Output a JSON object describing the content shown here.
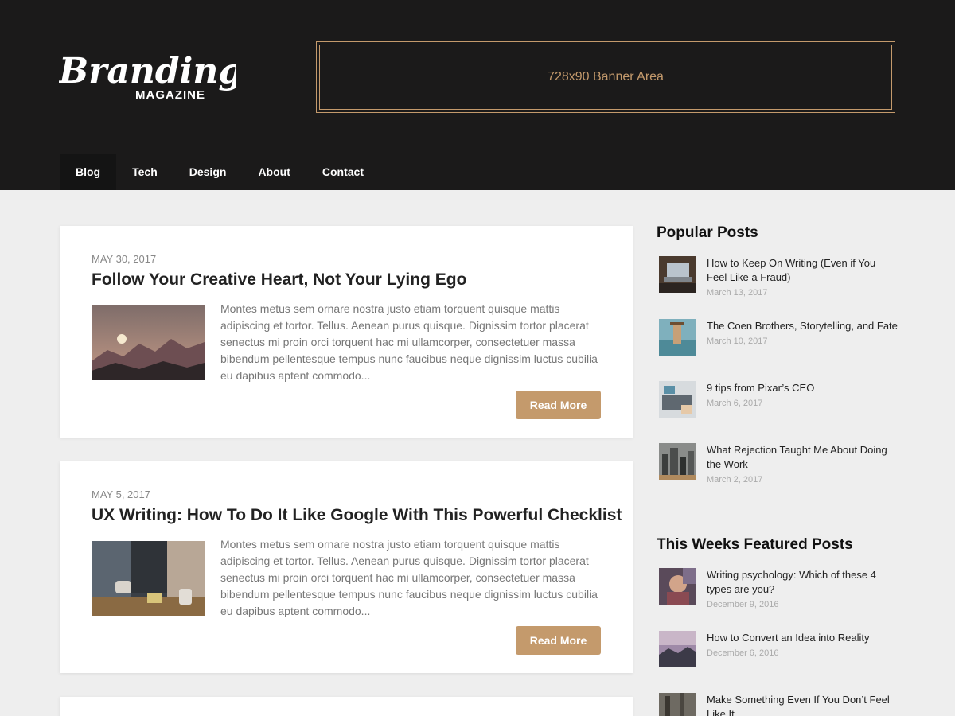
{
  "header": {
    "logo_text": "Branding",
    "logo_sub": "MAGAZINE",
    "banner_text": "728x90 Banner Area"
  },
  "nav": {
    "items": [
      {
        "label": "Blog"
      },
      {
        "label": "Tech"
      },
      {
        "label": "Design"
      },
      {
        "label": "About"
      },
      {
        "label": "Contact"
      }
    ]
  },
  "posts": [
    {
      "date": "MAY 30, 2017",
      "title": "Follow Your Creative Heart, Not Your Lying Ego",
      "excerpt": "Montes metus sem ornare nostra justo etiam torquent quisque mattis adipiscing et tortor. Tellus. Aenean purus quisque. Dignissim tortor placerat senectus mi proin orci torquent hac mi ullamcorper, consectetuer massa bibendum pellentesque tempus nunc faucibus neque dignissim luctus cubilia eu dapibus aptent commodo...",
      "read_more": "Read More"
    },
    {
      "date": "MAY 5, 2017",
      "title": "UX Writing: How To Do It Like Google With This Powerful Checklist",
      "excerpt": "Montes metus sem ornare nostra justo etiam torquent quisque mattis adipiscing et tortor. Tellus. Aenean purus quisque. Dignissim tortor placerat senectus mi proin orci torquent hac mi ullamcorper, consectetuer massa bibendum pellentesque tempus nunc faucibus neque dignissim luctus cubilia eu dapibus aptent commodo...",
      "read_more": "Read More"
    }
  ],
  "sidebar": {
    "popular_title": "Popular Posts",
    "popular": [
      {
        "title": "How to Keep On Writing (Even if You Feel Like a Fraud)",
        "date": "March 13, 2017"
      },
      {
        "title": "The Coen Brothers, Storytelling, and Fate",
        "date": "March 10, 2017"
      },
      {
        "title": "9 tips from Pixar’s CEO",
        "date": "March 6, 2017"
      },
      {
        "title": "What Rejection Taught Me About Doing the Work",
        "date": "March 2, 2017"
      }
    ],
    "featured_title": "This Weeks Featured Posts",
    "featured": [
      {
        "title": "Writing psychology: Which of these 4 types are you?",
        "date": "December 9, 2016"
      },
      {
        "title": "How to Convert an Idea into Reality",
        "date": "December 6, 2016"
      },
      {
        "title": "Make Something Even If You Don’t Feel Like It",
        "date": ""
      }
    ]
  },
  "colors": {
    "header_bg": "#1b1a1a",
    "accent": "#c49a6c",
    "page_bg": "#eeeeee"
  }
}
